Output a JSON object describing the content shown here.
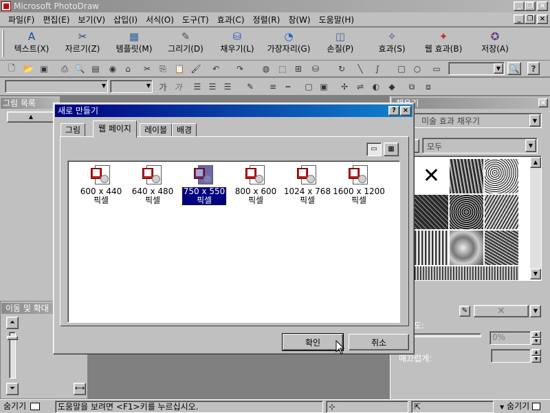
{
  "window": {
    "title": "Microsoft PhotoDraw",
    "min_label": "_",
    "restore_label": "❐",
    "close_label": "×"
  },
  "menu": {
    "items": [
      "파일(F)",
      "편집(E)",
      "보기(V)",
      "삽입(I)",
      "서식(O)",
      "도구(T)",
      "효과(C)",
      "정렬(R)",
      "창(W)",
      "도움말(H)"
    ],
    "doc_min": "_",
    "doc_restore": "❐",
    "doc_close": "×"
  },
  "visual_toolbar": {
    "buttons": [
      {
        "label": "텍스트(X)",
        "icon": "text-icon"
      },
      {
        "label": "자르기(Z)",
        "icon": "scissors-icon"
      },
      {
        "label": "템플릿(M)",
        "icon": "template-icon"
      },
      {
        "label": "그리기(D)",
        "icon": "draw-icon"
      },
      {
        "label": "채우기(L)",
        "icon": "fill-icon"
      },
      {
        "label": "가장자리(G)",
        "icon": "edge-icon"
      },
      {
        "label": "손질(P)",
        "icon": "touchup-icon"
      },
      {
        "label": "효과(S)",
        "icon": "effects-icon"
      },
      {
        "label": "웹 효과(B)",
        "icon": "web-effects-icon"
      },
      {
        "label": "저장(A)",
        "icon": "save-icon"
      }
    ]
  },
  "standard_toolbar": {
    "zoom_value": "",
    "help_label": "?"
  },
  "format_toolbar": {
    "font_value": "",
    "size_value": "",
    "bold_glyph": "가",
    "italic_glyph": "가"
  },
  "left_panel": {
    "title": "그림 목록",
    "scroll_up": "▲"
  },
  "pan_zoom": {
    "title": "이동 및 확대"
  },
  "right_panel": {
    "title": "채우기",
    "fill_type": "미술 효과 채우기",
    "category": "모두",
    "transparency_label": "투명도:",
    "transparency_value": "0%",
    "blur_label": "매끄럽게:"
  },
  "dialog": {
    "title": "새로 만들기",
    "help_label": "?",
    "close_label": "×",
    "tabs": [
      "그림",
      "웹 페이지",
      "레이블",
      "배경"
    ],
    "active_tab": 1,
    "items": [
      {
        "size": "600 x 440",
        "unit": "픽셀"
      },
      {
        "size": "640 x 480",
        "unit": "픽셀"
      },
      {
        "size": "750 x 550",
        "unit": "픽셀"
      },
      {
        "size": "800 x 600",
        "unit": "픽셀"
      },
      {
        "size": "1024 x 768",
        "unit": "픽셀"
      },
      {
        "size": "1600 x 1200",
        "unit": "픽셀"
      }
    ],
    "selected_index": 2,
    "ok_label": "확인",
    "cancel_label": "취소"
  },
  "status_bar": {
    "hide_label_left": "숨기기",
    "message": "도움말을 보려면 <F1>키를 누르십시오.",
    "hide_label_right": "숨기기"
  },
  "colors": {
    "face": "#c0c0c0",
    "workspace": "#808080",
    "active_title": "#000080",
    "inactive_title": "#808080",
    "selection": "#000080"
  }
}
